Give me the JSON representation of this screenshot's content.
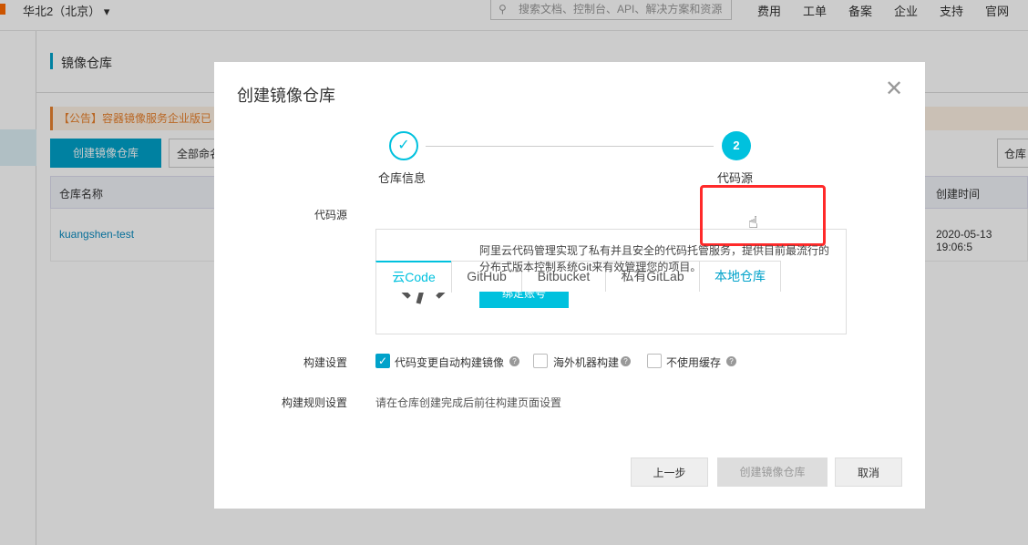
{
  "topbar": {
    "region": "华北2（北京）",
    "search_placeholder": "搜索文档、控制台、API、解决方案和资源",
    "nav": [
      "费用",
      "工单",
      "备案",
      "企业",
      "支持",
      "官网"
    ]
  },
  "page": {
    "title": "镜像仓库",
    "notice": "【公告】容器镜像服务企业版已",
    "create_button": "创建镜像仓库",
    "namespace_select": "全部命名",
    "repo_button": "仓库",
    "table": {
      "headers": [
        "仓库名称",
        "创建时间"
      ],
      "rows": [
        {
          "name": "kuangshen-test",
          "created": "2020-05-13 19:06:5"
        }
      ]
    }
  },
  "modal": {
    "title": "创建镜像仓库",
    "steps": [
      {
        "label": "仓库信息",
        "state": "done"
      },
      {
        "number": "2",
        "label": "代码源",
        "state": "active"
      }
    ],
    "source_label": "代码源",
    "tabs": [
      "云Code",
      "GitHub",
      "Bitbucket",
      "私有GitLab",
      "本地仓库"
    ],
    "active_tab": "云Code",
    "panel": {
      "description_line1": "阿里云代码管理实现了私有并且安全的代码托管服务，提供目前最流行的",
      "description_line2": "分布式版本控制系统Git来有效管理您的项目。",
      "bind_button": "绑定账号"
    },
    "build_label": "构建设置",
    "options": [
      {
        "label": "代码变更自动构建镜像",
        "checked": true
      },
      {
        "label": "海外机器构建",
        "checked": false
      },
      {
        "label": "不使用缓存",
        "checked": false
      }
    ],
    "rules_label": "构建规则设置",
    "rules_text": "请在仓库创建完成后前往构建页面设置",
    "buttons": {
      "prev": "上一步",
      "create": "创建镜像仓库",
      "cancel": "取消"
    }
  },
  "colors": {
    "accent": "#00c1de",
    "highlight": "#ff2a2a",
    "notice": "#e8812d"
  }
}
